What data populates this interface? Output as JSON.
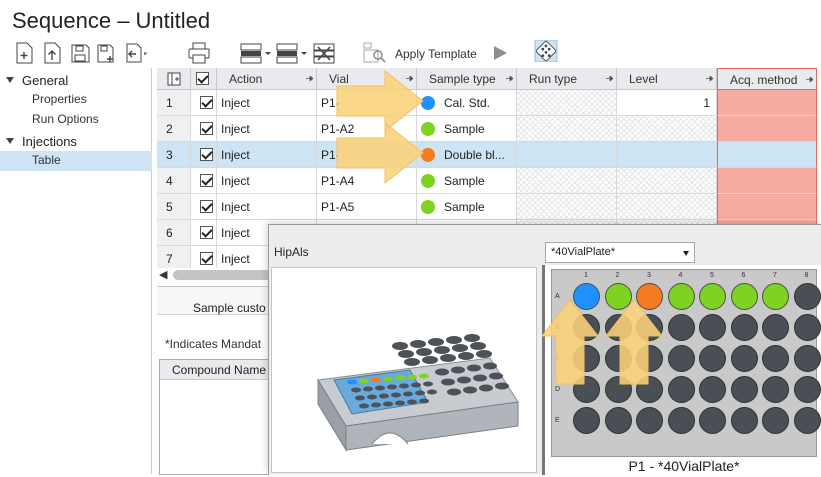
{
  "window": {
    "title": "Sequence – Untitled"
  },
  "toolbar": {
    "icons": [
      "new-icon",
      "import-icon",
      "save-icon",
      "save-as-icon",
      "export-icon",
      "print-icon",
      "insert-rows-icon",
      "append-rows-icon",
      "delete-rows-icon",
      "template-icon",
      "run-icon",
      "plate-view-icon"
    ],
    "apply_template_label": "Apply Template"
  },
  "nav": {
    "groups": [
      {
        "label": "General",
        "items": [
          "Properties",
          "Run Options"
        ]
      },
      {
        "label": "Injections",
        "items": [
          "Table"
        ]
      }
    ],
    "selected": "Table"
  },
  "grid": {
    "columns": [
      "",
      "",
      "Action",
      "Vial",
      "Sample type",
      "Run type",
      "Level",
      "Acq. method"
    ],
    "rows": [
      {
        "num": "1",
        "checked": true,
        "action": "Inject",
        "vial": "P1-",
        "sample_type": "Cal. Std.",
        "dot": "#1e90ff",
        "level": "1"
      },
      {
        "num": "2",
        "checked": true,
        "action": "Inject",
        "vial": "P1-A2",
        "sample_type": "Sample",
        "dot": "#7ed321",
        "level": ""
      },
      {
        "num": "3",
        "checked": true,
        "action": "Inject",
        "vial": "P1-",
        "sample_type": "Double bl...",
        "dot": "#f57c20",
        "level": ""
      },
      {
        "num": "4",
        "checked": true,
        "action": "Inject",
        "vial": "P1-A4",
        "sample_type": "Sample",
        "dot": "#7ed321",
        "level": ""
      },
      {
        "num": "5",
        "checked": true,
        "action": "Inject",
        "vial": "P1-A5",
        "sample_type": "Sample",
        "dot": "#7ed321",
        "level": ""
      },
      {
        "num": "6",
        "checked": true,
        "action": "Inject",
        "vial": "",
        "sample_type": "",
        "dot": "",
        "level": ""
      },
      {
        "num": "7",
        "checked": true,
        "action": "Inject",
        "vial": "",
        "sample_type": "",
        "dot": "",
        "level": ""
      }
    ],
    "selected_row": "3"
  },
  "lower_panel": {
    "tab_label": "Sample custo",
    "mandatory_note": "*Indicates Mandat",
    "compound_header": "Compound Name"
  },
  "popup": {
    "device_label": "HipAls",
    "plate_select": "*40VialPlate*",
    "plate_caption": "P1 - *40VialPlate*",
    "col_labels": [
      "1",
      "2",
      "3",
      "4",
      "5",
      "6",
      "7",
      "8"
    ],
    "row_labels": [
      "A",
      "B",
      "C",
      "D",
      "E"
    ],
    "highlighted_wells": [
      {
        "well": "A1",
        "color": "#1e90ff"
      },
      {
        "well": "A2",
        "color": "#7ed321"
      },
      {
        "well": "A3",
        "color": "#f57c20"
      },
      {
        "well": "A4",
        "color": "#7ed321"
      },
      {
        "well": "A5",
        "color": "#7ed321"
      },
      {
        "well": "A6",
        "color": "#7ed321"
      },
      {
        "well": "A7",
        "color": "#7ed321"
      }
    ]
  },
  "colors": {
    "selection": "#cde4f5",
    "acq_method_error": "#f7aaa0",
    "annotation_arrow": "#fbd27a",
    "cal_std": "#1e90ff",
    "sample": "#7ed321",
    "double_blank": "#f57c20"
  }
}
